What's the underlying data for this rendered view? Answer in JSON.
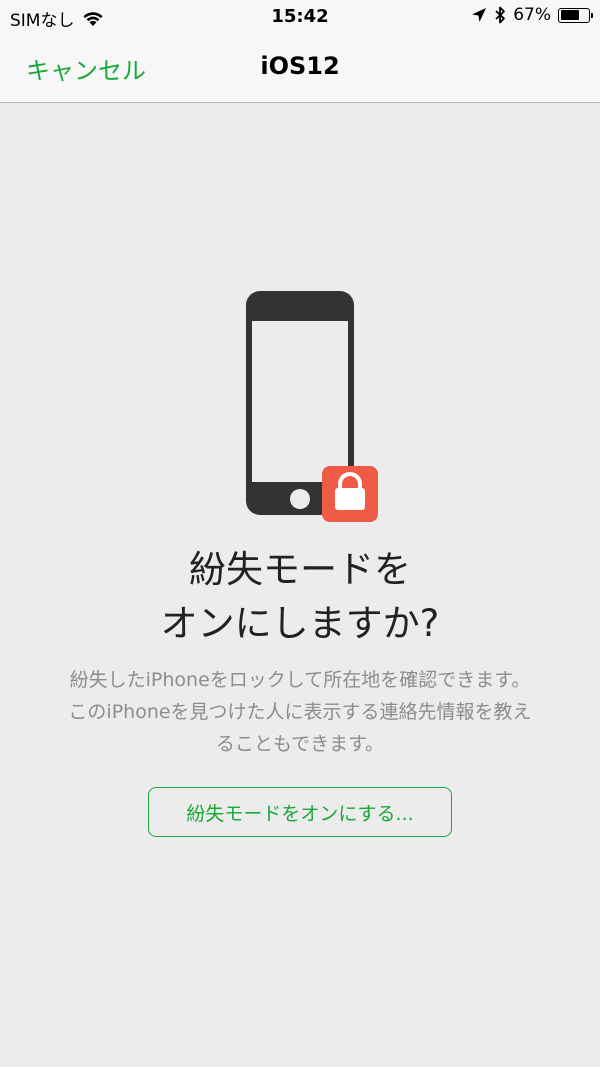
{
  "status_bar": {
    "carrier": "SIMなし",
    "time": "15:42",
    "battery_percent": "67%",
    "battery_level": 0.67,
    "icons": [
      "wifi-icon",
      "location-arrow-icon",
      "bluetooth-icon",
      "battery-icon"
    ]
  },
  "nav": {
    "cancel_label": "キャンセル",
    "title": "iOS12"
  },
  "illustration": {
    "icons": [
      "iphone-icon",
      "lock-icon"
    ],
    "lock_badge_color": "#ef5b45",
    "phone_color": "#333333"
  },
  "content": {
    "headline_line1": "紛失モードを",
    "headline_line2": "オンにしますか?",
    "description_line1": "紛失したiPhoneをロックして所在地を確認できます。",
    "description_line2": "このiPhoneを見つけた人に表示する連絡先情報を教え",
    "description_line3": "ることもできます。",
    "action_label": "紛失モードをオンにする..."
  },
  "colors": {
    "accent": "#19a83a",
    "background": "#ececec",
    "bar_background": "#f7f7f7"
  }
}
